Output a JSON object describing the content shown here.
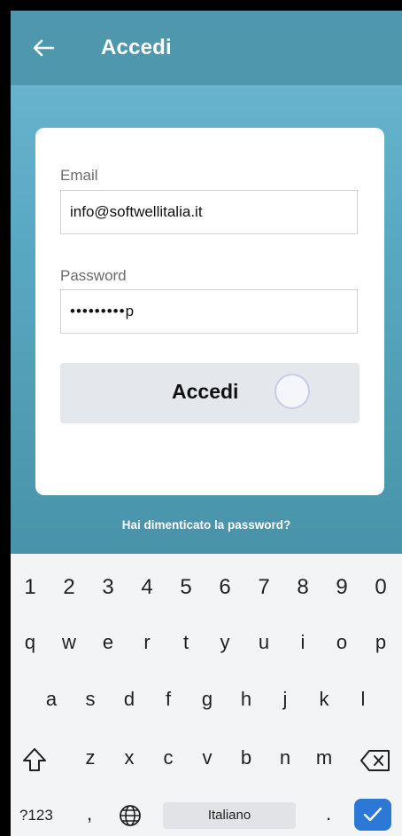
{
  "app_bar": {
    "title": "Accedi",
    "back_icon": "arrow-left-icon"
  },
  "form": {
    "email_label": "Email",
    "email_value": "info@softwellitalia.it",
    "password_label": "Password",
    "password_value": "•••••••••p",
    "submit_label": "Accedi",
    "forgot_link": "Hai dimenticato la password?"
  },
  "keyboard": {
    "numbers": [
      "1",
      "2",
      "3",
      "4",
      "5",
      "6",
      "7",
      "8",
      "9",
      "0"
    ],
    "row1": [
      "q",
      "w",
      "e",
      "r",
      "t",
      "y",
      "u",
      "i",
      "o",
      "p"
    ],
    "row2": [
      "a",
      "s",
      "d",
      "f",
      "g",
      "h",
      "j",
      "k",
      "l"
    ],
    "row3": [
      "z",
      "x",
      "c",
      "v",
      "b",
      "n",
      "m"
    ],
    "symbols_key": "?123",
    "comma_key": ",",
    "space_label": "Italiano",
    "period_key": ".",
    "icons": {
      "shift": "shift-icon",
      "backspace": "backspace-icon",
      "globe": "globe-icon",
      "enter": "check-icon"
    }
  },
  "colors": {
    "app_bar": "#4f97ad",
    "background": "#5aa9c4",
    "enter_key": "#2b78d7"
  }
}
